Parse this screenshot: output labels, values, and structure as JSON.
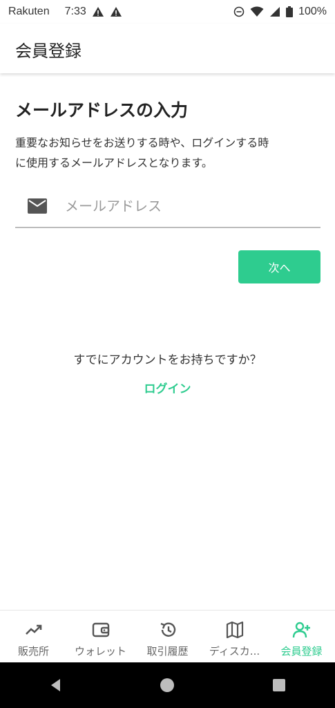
{
  "status_bar": {
    "carrier": "Rakuten",
    "time": "7:33",
    "battery": "100%"
  },
  "app_bar": {
    "title": "会員登録"
  },
  "main": {
    "heading": "メールアドレスの入力",
    "description_line1": "重要なお知らせをお送りする時や、ログインする時",
    "description_line2": "に使用するメールアドレスとなります。",
    "email_placeholder": "メールアドレス",
    "email_value": "",
    "next_button": "次へ",
    "have_account_text": "すでにアカウントをお持ちですか？",
    "login_link": "ログイン"
  },
  "bottom_nav": {
    "items": [
      {
        "label": "販売所",
        "icon": "trending-up-icon"
      },
      {
        "label": "ウォレット",
        "icon": "wallet-icon"
      },
      {
        "label": "取引履歴",
        "icon": "history-icon"
      },
      {
        "label": "ディスカ...",
        "icon": "map-icon"
      },
      {
        "label": "会員登録",
        "icon": "add-user-icon",
        "active": true
      }
    ]
  },
  "colors": {
    "accent": "#2ecc8f",
    "system_nav_bg": "#000000"
  }
}
